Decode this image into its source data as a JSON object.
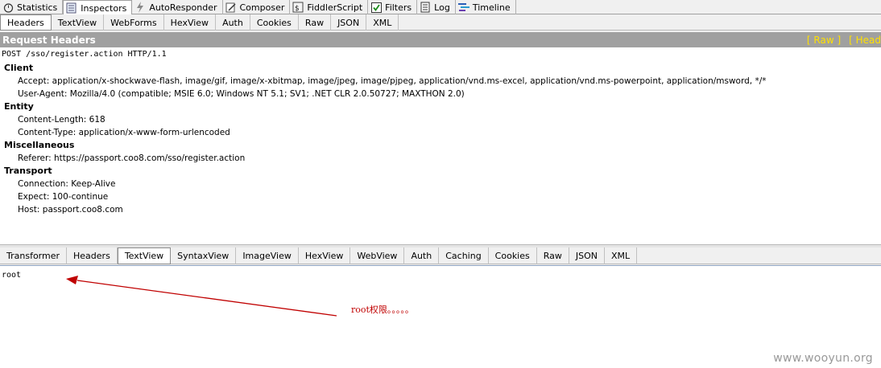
{
  "main_tabs": [
    {
      "label": "Statistics",
      "icon": "stopwatch-icon"
    },
    {
      "label": "Inspectors",
      "icon": "magnifier-icon"
    },
    {
      "label": "AutoResponder",
      "icon": "lightning-icon"
    },
    {
      "label": "Composer",
      "icon": "pencil-icon"
    },
    {
      "label": "FiddlerScript",
      "icon": "script-icon"
    },
    {
      "label": "Filters",
      "icon": "checkbox-icon"
    },
    {
      "label": "Log",
      "icon": "document-icon"
    },
    {
      "label": "Timeline",
      "icon": "timeline-icon"
    }
  ],
  "request_tabs": [
    "Headers",
    "TextView",
    "WebForms",
    "HexView",
    "Auth",
    "Cookies",
    "Raw",
    "JSON",
    "XML"
  ],
  "request_panel": {
    "title": "Request Headers",
    "links": [
      "[ Raw ]",
      "[ Head"
    ],
    "request_line": "POST /sso/register.action HTTP/1.1",
    "sections": [
      {
        "name": "Client",
        "headers": [
          "Accept: application/x-shockwave-flash, image/gif, image/x-xbitmap, image/jpeg, image/pjpeg, application/vnd.ms-excel, application/vnd.ms-powerpoint, application/msword, */*",
          "User-Agent: Mozilla/4.0 (compatible; MSIE 6.0; Windows NT 5.1; SV1; .NET CLR 2.0.50727; MAXTHON 2.0)"
        ]
      },
      {
        "name": "Entity",
        "headers": [
          "Content-Length: 618",
          "Content-Type: application/x-www-form-urlencoded"
        ]
      },
      {
        "name": "Miscellaneous",
        "headers": [
          "Referer: https://passport.coo8.com/sso/register.action"
        ]
      },
      {
        "name": "Transport",
        "headers": [
          "Connection: Keep-Alive",
          "Expect: 100-continue",
          "Host: passport.coo8.com"
        ]
      }
    ]
  },
  "response_tabs": [
    "Transformer",
    "Headers",
    "TextView",
    "SyntaxView",
    "ImageView",
    "HexView",
    "WebView",
    "Auth",
    "Caching",
    "Cookies",
    "Raw",
    "JSON",
    "XML"
  ],
  "response": {
    "body_text": "root",
    "annotation": "root权限。。。。。",
    "annotation_color": "#c00000"
  },
  "watermark": "www.wooyun.org"
}
